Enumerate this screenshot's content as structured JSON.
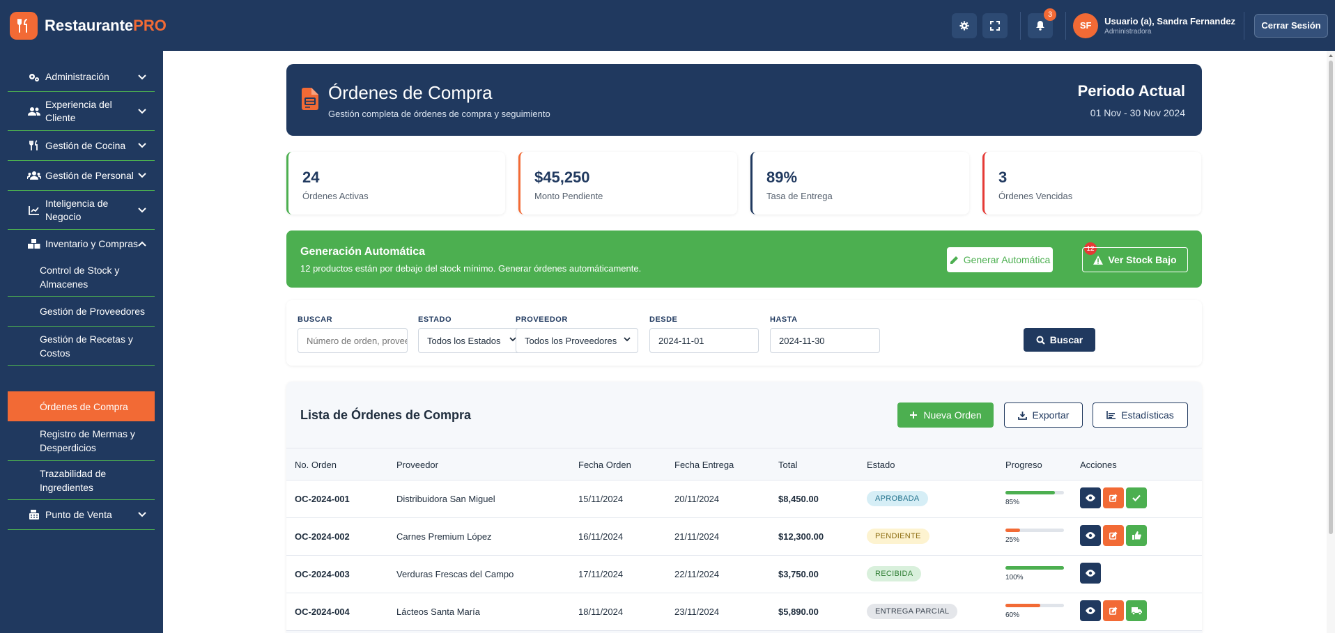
{
  "app": {
    "brand_main": "Restaurante",
    "brand_accent": "PRO"
  },
  "topbar": {
    "notification_count": "3",
    "avatar_initials": "SF",
    "user_name": "Usuario (a), Sandra Fernandez",
    "user_role": "Administradora",
    "logout_label": "Cerrar Sesión"
  },
  "sidebar": {
    "items": [
      {
        "label": "Administración",
        "icon": "gears-icon"
      },
      {
        "label": "Experiencia del Cliente",
        "icon": "users-icon"
      },
      {
        "label": "Gestión de Cocina",
        "icon": "utensils-icon"
      },
      {
        "label": "Gestión de Personal",
        "icon": "team-icon"
      },
      {
        "label": "Inteligencia de Negocio",
        "icon": "chart-line-icon"
      },
      {
        "label": "Inventario y Compras",
        "icon": "boxes-icon"
      },
      {
        "label": "Punto de Venta",
        "icon": "cash-register-icon"
      }
    ],
    "subitems": [
      {
        "label": "Control de Stock y Almacenes"
      },
      {
        "label": "Gestión de Proveedores"
      },
      {
        "label": "Gestión de Recetas y Costos"
      },
      {
        "label": "Órdenes de Compra",
        "active": true
      },
      {
        "label": "Registro de Mermas y Desperdicios"
      },
      {
        "label": "Trazabilidad de Ingredientes"
      }
    ]
  },
  "header": {
    "title": "Órdenes de Compra",
    "subtitle": "Gestión completa de órdenes de compra y seguimiento",
    "period_title": "Periodo Actual",
    "period_range": "01 Nov - 30 Nov 2024"
  },
  "stats": [
    {
      "value": "24",
      "label": "Órdenes Activas",
      "color": "#4caf50"
    },
    {
      "value": "$45,250",
      "label": "Monto Pendiente",
      "color": "#f26a35"
    },
    {
      "value": "89%",
      "label": "Tasa de Entrega",
      "color": "#20395f"
    },
    {
      "value": "3",
      "label": "Órdenes Vencidas",
      "color": "#e53935"
    }
  ],
  "auto": {
    "title": "Generación Automática",
    "description": "12 productos están por debajo del stock mínimo. Generar órdenes automáticamente.",
    "generate_label": "Generar Automática",
    "badge": "12",
    "low_stock_label": "Ver Stock Bajo"
  },
  "filters": {
    "search_label": "BUSCAR",
    "search_placeholder": "Número de orden, proveedor...",
    "status_label": "ESTADO",
    "status_value": "Todos los Estados",
    "supplier_label": "PROVEEDOR",
    "supplier_value": "Todos los Proveedores",
    "from_label": "DESDE",
    "from_value": "2024-11-01",
    "to_label": "HASTA",
    "to_value": "2024-11-30",
    "search_button": "Buscar"
  },
  "list": {
    "title": "Lista de Órdenes de Compra",
    "new_label": "Nueva Orden",
    "export_label": "Exportar",
    "stats_label": "Estadísticas",
    "columns": [
      "No. Orden",
      "Proveedor",
      "Fecha Orden",
      "Fecha Entrega",
      "Total",
      "Estado",
      "Progreso",
      "Acciones"
    ],
    "rows": [
      {
        "id": "OC-2024-001",
        "supplier": "Distribuidora San Miguel",
        "order_date": "15/11/2024",
        "delivery_date": "20/11/2024",
        "total": "$8,450.00",
        "status": "APROBADA",
        "status_bg": "#d6eef6",
        "status_fg": "#1e6f8a",
        "progress": 85,
        "progress_label": "85%",
        "progress_color": "#4caf50",
        "actions": [
          "eye-icon",
          "edit-icon",
          "check-icon"
        ]
      },
      {
        "id": "OC-2024-002",
        "supplier": "Carnes Premium López",
        "order_date": "16/11/2024",
        "delivery_date": "21/11/2024",
        "total": "$12,300.00",
        "status": "PENDIENTE",
        "status_bg": "#fdf3d0",
        "status_fg": "#8a6a0d",
        "progress": 25,
        "progress_label": "25%",
        "progress_color": "#f26a35",
        "actions": [
          "eye-icon",
          "edit-icon",
          "thumbs-up-icon"
        ]
      },
      {
        "id": "OC-2024-003",
        "supplier": "Verduras Frescas del Campo",
        "order_date": "17/11/2024",
        "delivery_date": "22/11/2024",
        "total": "$3,750.00",
        "status": "RECIBIDA",
        "status_bg": "#d9f0dc",
        "status_fg": "#2e7d32",
        "progress": 100,
        "progress_label": "100%",
        "progress_color": "#4caf50",
        "actions": [
          "eye-icon"
        ]
      },
      {
        "id": "OC-2024-004",
        "supplier": "Lácteos Santa María",
        "order_date": "18/11/2024",
        "delivery_date": "23/11/2024",
        "total": "$5,890.00",
        "status": "ENTREGA PARCIAL",
        "status_bg": "#e4e6ea",
        "status_fg": "#3a4450",
        "progress": 60,
        "progress_label": "60%",
        "progress_color": "#f26a35",
        "actions": [
          "eye-icon",
          "edit-icon",
          "truck-icon"
        ]
      }
    ]
  }
}
